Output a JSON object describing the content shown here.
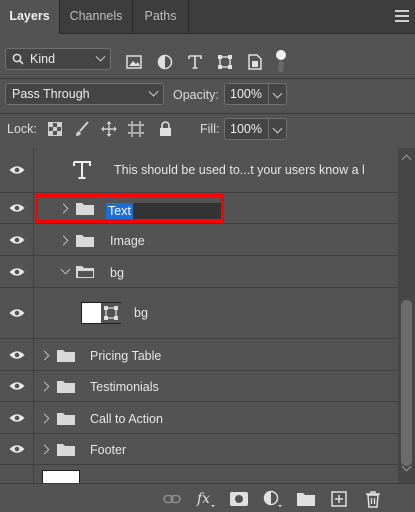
{
  "tabs": [
    {
      "label": "Layers",
      "active": true
    },
    {
      "label": "Channels",
      "active": false
    },
    {
      "label": "Paths",
      "active": false
    }
  ],
  "filter": {
    "kind_label": "Kind",
    "icons": [
      "image-filter-icon",
      "adjustment-filter-icon",
      "type-filter-icon",
      "shape-filter-icon",
      "smart-object-filter-icon",
      "filter-toggle-icon"
    ]
  },
  "blend": {
    "mode": "Pass Through",
    "opacity_label": "Opacity:",
    "opacity_value": "100%"
  },
  "lock": {
    "label": "Lock:",
    "fill_label": "Fill:",
    "fill_value": "100%",
    "icons": [
      "lock-transparent-pixels-icon",
      "lock-image-pixels-icon",
      "lock-position-icon",
      "lock-artboard-icon",
      "lock-all-icon"
    ]
  },
  "layers": [
    {
      "name": "This should be used to...t your users know a l",
      "type": "text"
    },
    {
      "name": "Text",
      "type": "group",
      "editing": true
    },
    {
      "name": "Image",
      "type": "group"
    },
    {
      "name": "bg",
      "type": "group",
      "expanded": true
    },
    {
      "name": "bg",
      "type": "shape"
    },
    {
      "name": "Pricing Table",
      "type": "group"
    },
    {
      "name": "Testimonials",
      "type": "group"
    },
    {
      "name": "Call to Action",
      "type": "group"
    },
    {
      "name": "Footer",
      "type": "group"
    }
  ],
  "bottom_icons": [
    "link-layers-icon",
    "fx-icon",
    "add-mask-icon",
    "new-adjustment-icon",
    "new-group-icon",
    "new-layer-icon",
    "delete-layer-icon"
  ],
  "colors": {
    "panel_bg": "#535353",
    "highlight_border": "#ff0000",
    "selection_blue": "#1d6ed6"
  }
}
